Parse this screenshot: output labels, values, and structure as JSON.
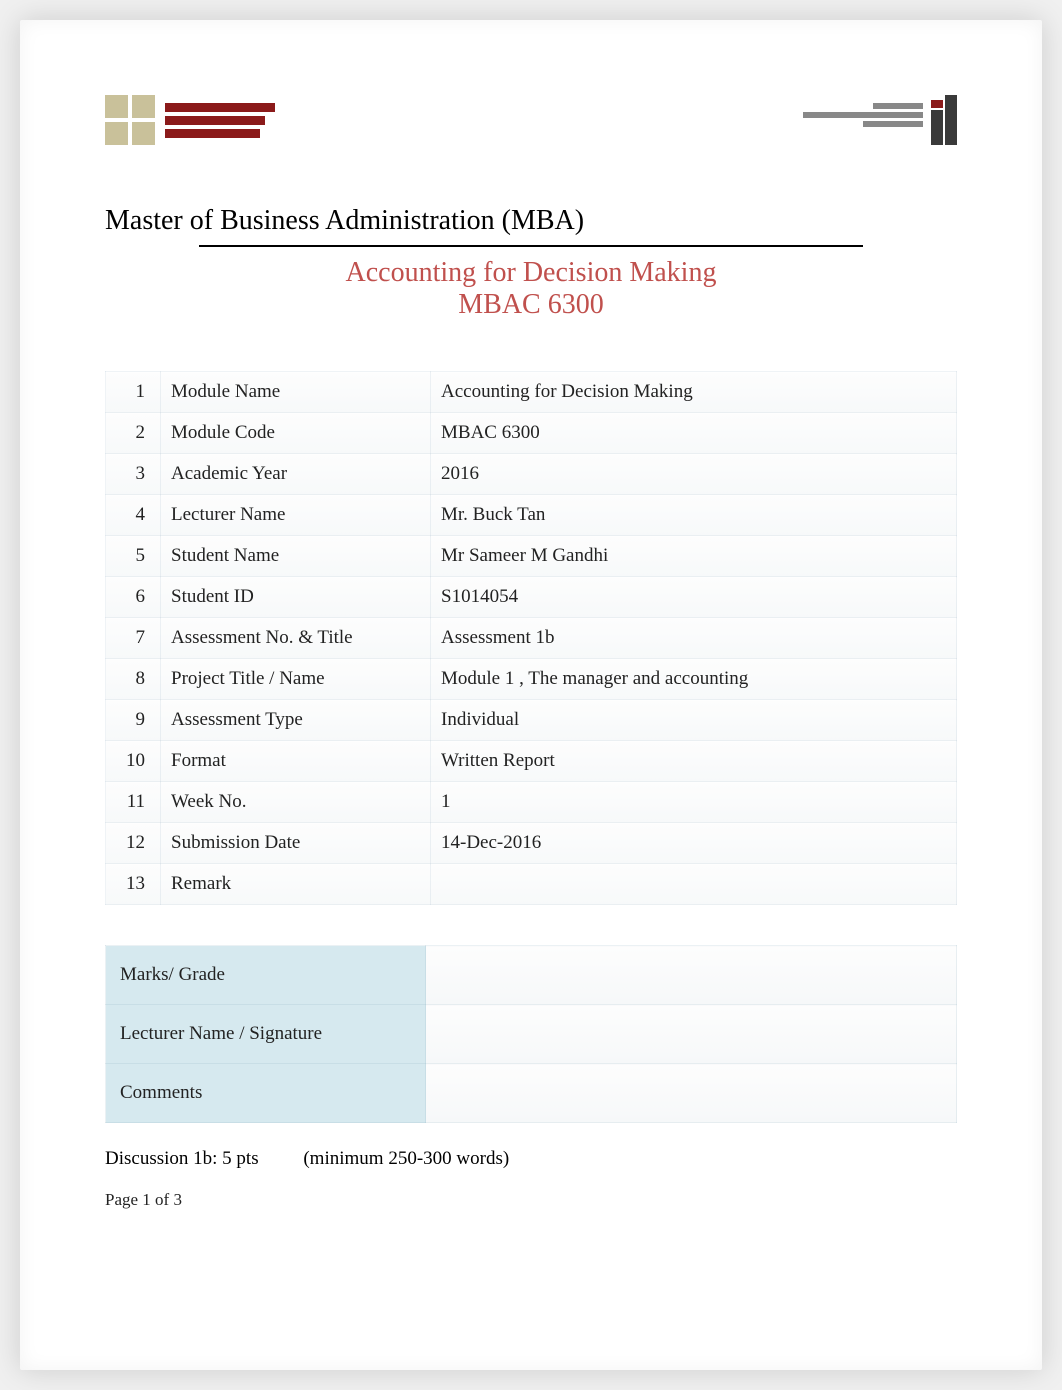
{
  "header": {
    "program_title": "Master of Business Administration (MBA)",
    "course_title": "Accounting for Decision Making",
    "course_code": "MBAC 6300"
  },
  "info_rows": [
    {
      "n": "1",
      "label": "Module   Name",
      "value": "Accounting for Decision Making"
    },
    {
      "n": "2",
      "label": "Module Code",
      "value": "MBAC 6300"
    },
    {
      "n": "3",
      "label": "Academic Year",
      "value": "2016"
    },
    {
      "n": "4",
      "label": "Lecturer Name",
      "value": "Mr. Buck Tan"
    },
    {
      "n": "5",
      "label": "Student Name",
      "value": "Mr Sameer M Gandhi"
    },
    {
      "n": "6",
      "label": "Student ID",
      "value": "S1014054"
    },
    {
      "n": "7",
      "label": "Assessment No. & Title",
      "value": "Assessment 1b"
    },
    {
      "n": "8",
      "label": "Project Title / Name",
      "value": "Module 1 , The manager and accounting"
    },
    {
      "n": "9",
      "label": "Assessment Type",
      "value": "Individual"
    },
    {
      "n": "10",
      "label": "Format",
      "value": "Written Report"
    },
    {
      "n": "11",
      "label": "Week No.",
      "value": "1"
    },
    {
      "n": "12",
      "label": "Submission Date",
      "value": "14-Dec-2016"
    },
    {
      "n": "13",
      "label": "Remark",
      "value": ""
    }
  ],
  "grade_rows": [
    {
      "label": "Marks/ Grade",
      "value": ""
    },
    {
      "label": "Lecturer Name / Signature",
      "value": ""
    },
    {
      "label": "Comments",
      "value": ""
    }
  ],
  "discussion": {
    "label": "Discussion 1b: 5 pts",
    "note": "(minimum 250-300 words)"
  },
  "footer": {
    "page_prefix": "Page ",
    "page_current": "1",
    "page_sep": " of ",
    "page_total": "3"
  }
}
